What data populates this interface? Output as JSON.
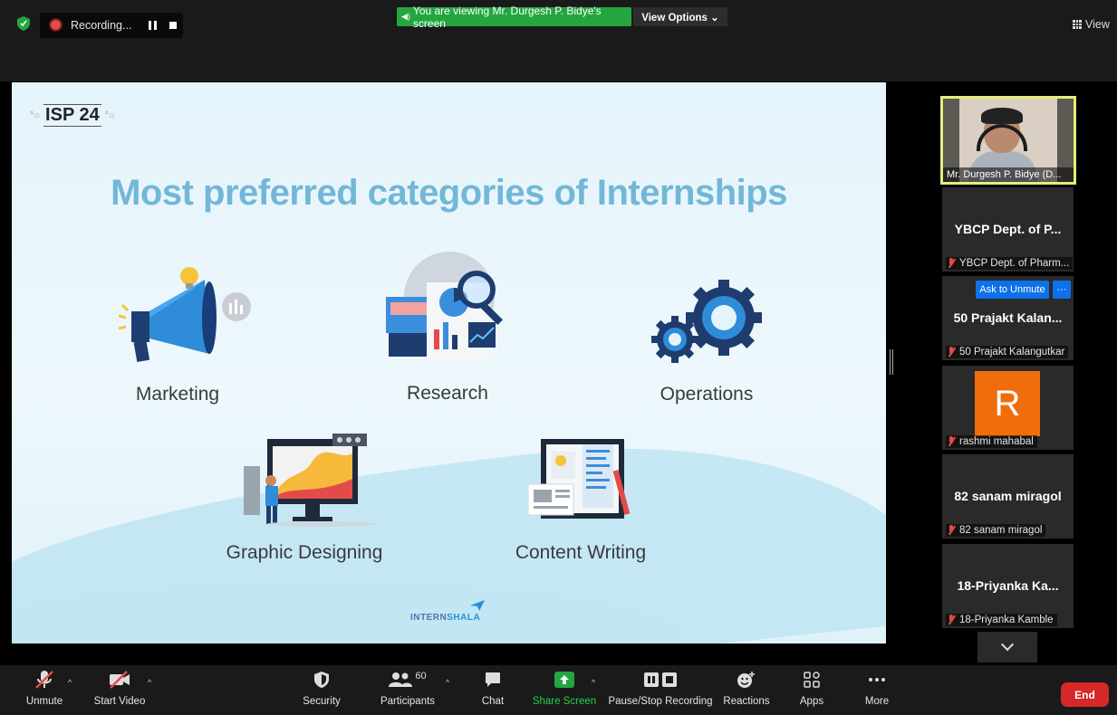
{
  "top": {
    "recording_label": "Recording...",
    "viewing_banner": "You are viewing Mr. Durgesh P. Bidye's screen",
    "view_options": "View Options ⌄",
    "view_label": "View"
  },
  "slide": {
    "logo": "ISP 24",
    "title": "Most preferred categories of Internships",
    "categories": [
      "Marketing",
      "Research",
      "Operations",
      "Graphic Designing",
      "Content Writing"
    ],
    "brand_a": "INTERN",
    "brand_b": "SHALA"
  },
  "participants": {
    "speaker_caption": "Mr. Durgesh P. Bidye (D...",
    "tiles": [
      {
        "big": "YBCP Dept. of P...",
        "small": "YBCP Dept. of Pharm..."
      },
      {
        "big": "50 Prajakt Kalan...",
        "small": "50 Prajakt Kalangutkar"
      },
      {
        "avatar": "R",
        "small": "rashmi mahabal"
      },
      {
        "big": "82 sanam miragol",
        "small": "82 sanam miragol"
      },
      {
        "big": "18-Priyanka Ka...",
        "small": "18-Priyanka Kamble"
      }
    ],
    "ask_to_unmute": "Ask to Unmute",
    "more_dots": "···"
  },
  "toolbar": {
    "unmute": "Unmute",
    "start_video": "Start Video",
    "security": "Security",
    "participants": "Participants",
    "participants_count": "60",
    "chat": "Chat",
    "share_screen": "Share Screen",
    "pause_stop": "Pause/Stop Recording",
    "reactions": "Reactions",
    "apps": "Apps",
    "more": "More",
    "end": "End"
  },
  "colors": {
    "share_green": "#23a640",
    "end_red": "#d52828",
    "ask_blue": "#0e71eb",
    "speaker_border": "#e6ec7a",
    "title_blue": "#72b7d8",
    "avatar_orange": "#ef6e0b"
  }
}
